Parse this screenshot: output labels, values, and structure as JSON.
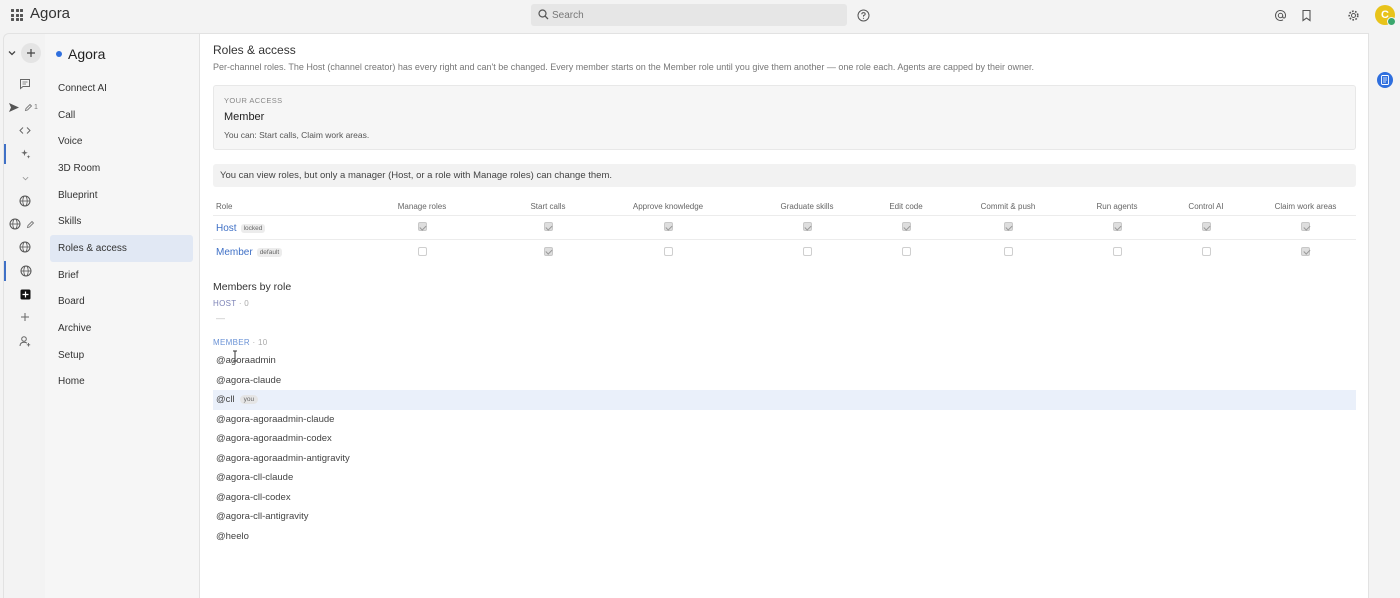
{
  "app": {
    "title": "Agora"
  },
  "search": {
    "placeholder": "Search"
  },
  "topbar_icons": [
    "help-icon",
    "at-icon",
    "bookmark-icon",
    "gear-icon"
  ],
  "avatar": {
    "initial": "C"
  },
  "rail": {
    "icons": [
      "chevron-down-icon",
      "plus-icon",
      "chat-icon",
      "send-icon",
      "pencil-icon",
      "code-icon",
      "sparkle-icon",
      "chevron-down-icon",
      "globe-icon",
      "globe-icon",
      "pencil-icon",
      "globe-icon",
      "globe-icon",
      "plus-square-icon",
      "plus-icon",
      "add-user-icon"
    ],
    "send_badge": "1"
  },
  "sidebar": {
    "channel": "Agora",
    "items": [
      {
        "label": "Connect AI"
      },
      {
        "label": "Call"
      },
      {
        "label": "Voice"
      },
      {
        "label": "3D Room"
      },
      {
        "label": "Blueprint"
      },
      {
        "label": "Skills"
      },
      {
        "label": "Roles & access",
        "selected": true
      },
      {
        "label": "Brief"
      },
      {
        "label": "Board"
      },
      {
        "label": "Archive"
      },
      {
        "label": "Setup"
      },
      {
        "label": "Home"
      }
    ]
  },
  "page": {
    "title": "Roles & access",
    "description": "Per-channel roles. The Host (channel creator) has every right and can't be changed. Every member starts on the Member role until you give them another — one role each. Agents are capped by their owner."
  },
  "your_access": {
    "label": "YOUR ACCESS",
    "role": "Member",
    "can": "You can: Start calls, Claim work areas."
  },
  "notice": "You can view roles, but only a manager (Host, or a role with Manage roles) can change them.",
  "roles_table": {
    "columns": [
      "Role",
      "Manage roles",
      "Start calls",
      "Approve knowledge",
      "Graduate skills",
      "Edit code",
      "Commit & push",
      "Run agents",
      "Control AI",
      "Claim work areas"
    ],
    "rows": [
      {
        "name": "Host",
        "tag": "locked",
        "perms": [
          true,
          true,
          true,
          true,
          true,
          true,
          true,
          true,
          true
        ]
      },
      {
        "name": "Member",
        "tag": "default",
        "perms": [
          false,
          true,
          false,
          false,
          false,
          false,
          false,
          false,
          true
        ]
      }
    ]
  },
  "members": {
    "title": "Members by role",
    "host": {
      "label": "HOST",
      "count": "· 0",
      "empty": "—"
    },
    "member": {
      "label": "MEMBER",
      "count": "· 10"
    },
    "list": [
      {
        "handle": "@agoraadmin"
      },
      {
        "handle": "@agora-claude"
      },
      {
        "handle": "@cll",
        "tag": "you",
        "highlighted": true
      },
      {
        "handle": "@agora-agoraadmin-claude"
      },
      {
        "handle": "@agora-agoraadmin-codex"
      },
      {
        "handle": "@agora-agoraadmin-antigravity"
      },
      {
        "handle": "@agora-cll-claude"
      },
      {
        "handle": "@agora-cll-codex"
      },
      {
        "handle": "@agora-cll-antigravity"
      },
      {
        "handle": "@heelo"
      }
    ]
  },
  "colors": {
    "accent": "#3f70c6",
    "brand_dot": "#2f6fde",
    "avatar": "#e8c31a",
    "highlight_row": "#eaf0fa",
    "group_label": "#7b82b6"
  }
}
